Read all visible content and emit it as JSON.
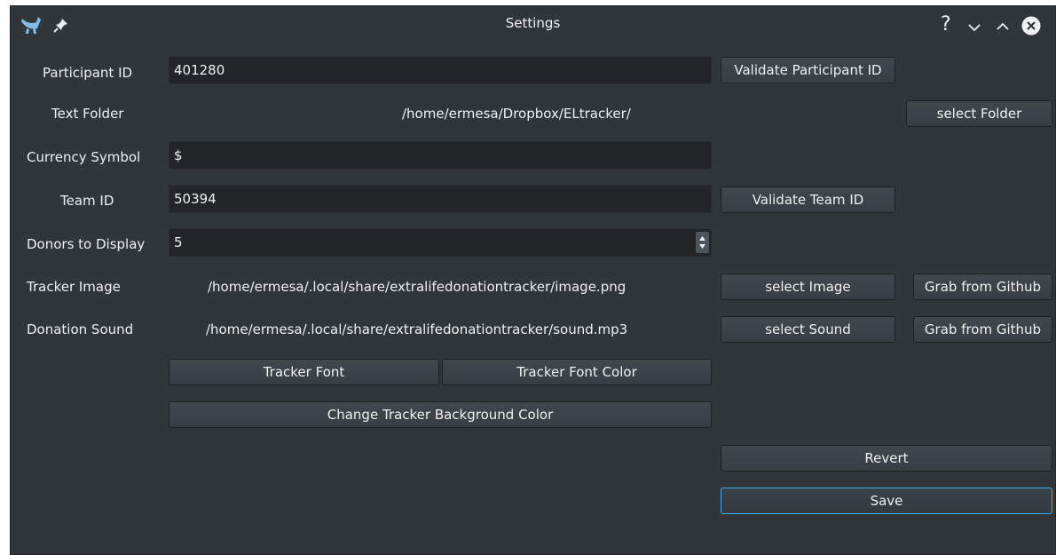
{
  "window": {
    "title": "Settings",
    "titlebar_icons": [
      "app-logo-icon",
      "pin-icon",
      "help-icon",
      "minimize-icon",
      "maximize-icon",
      "close-icon"
    ],
    "help_glyph": "?",
    "colors": {
      "background": "#31363b",
      "field": "#232629",
      "button": "#3e444a",
      "focus": "#3daee9",
      "text": "#eff0f1"
    }
  },
  "participant": {
    "label": "Participant ID",
    "value": "401280",
    "button": "Validate Participant ID"
  },
  "text_folder": {
    "label": "Text Folder",
    "path": "/home/ermesa/Dropbox/ELtracker/",
    "button": "select Folder"
  },
  "currency": {
    "label": "Currency Symbol",
    "value": "$"
  },
  "team": {
    "label": "Team ID",
    "value": "50394",
    "button": "Validate Team ID"
  },
  "donors": {
    "label": "Donors to Display",
    "value": "5"
  },
  "tracker_image": {
    "label": "Tracker Image",
    "path": "/home/ermesa/.local/share/extralifedonationtracker/image.png",
    "select_button": "select Image",
    "github_button": "Grab from Github"
  },
  "donation_sound": {
    "label": "Donation Sound",
    "path": "/home/ermesa/.local/share/extralifedonationtracker/sound.mp3",
    "select_button": "select Sound",
    "github_button": "Grab from Github"
  },
  "font_buttons": {
    "font": "Tracker Font",
    "font_color": "Tracker Font Color",
    "background": "Change Tracker Background Color"
  },
  "actions": {
    "revert": "Revert",
    "save": "Save"
  }
}
